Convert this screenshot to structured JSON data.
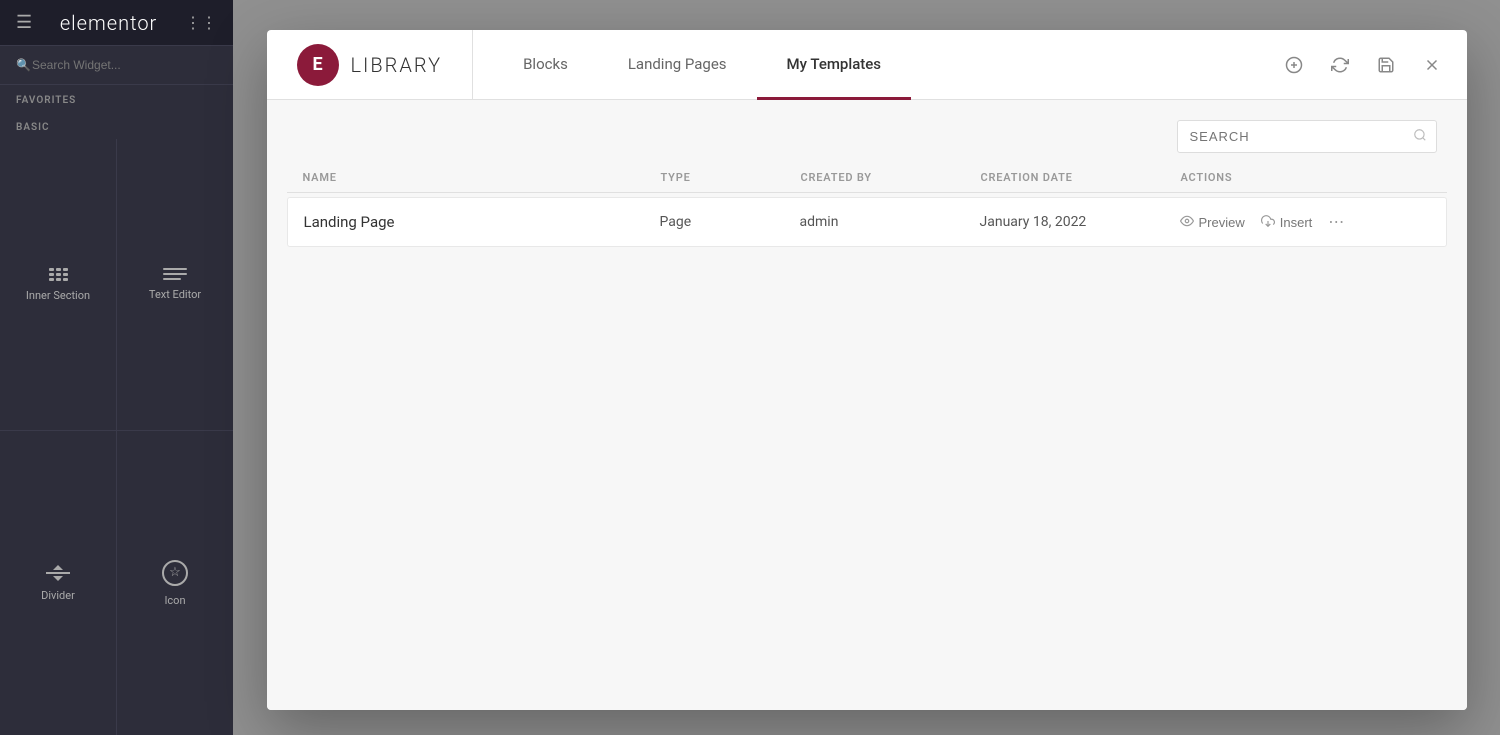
{
  "sidebar": {
    "logo_text": "elementor",
    "search_placeholder": "Search Widget...",
    "favorites_label": "FAVORITES",
    "basic_label": "BASIC",
    "widgets": [
      {
        "id": "inner-section",
        "label": "Inner Section"
      },
      {
        "id": "text-editor",
        "label": "Text Editor"
      },
      {
        "id": "divider",
        "label": "Divider"
      },
      {
        "id": "icon",
        "label": "Icon"
      }
    ]
  },
  "modal": {
    "brand_letter": "E",
    "library_title": "LIBRARY",
    "tabs": [
      {
        "id": "blocks",
        "label": "Blocks",
        "active": false
      },
      {
        "id": "landing-pages",
        "label": "Landing Pages",
        "active": false
      },
      {
        "id": "my-templates",
        "label": "My Templates",
        "active": true
      }
    ],
    "search_placeholder": "SEARCH",
    "table": {
      "headers": [
        {
          "id": "name",
          "label": "NAME"
        },
        {
          "id": "type",
          "label": "TYPE"
        },
        {
          "id": "created-by",
          "label": "CREATED BY"
        },
        {
          "id": "creation-date",
          "label": "CREATION DATE"
        },
        {
          "id": "actions",
          "label": "ACTIONS"
        }
      ],
      "rows": [
        {
          "name": "Landing Page",
          "type": "Page",
          "created_by": "admin",
          "creation_date": "January 18, 2022",
          "preview_label": "Preview",
          "insert_label": "Insert"
        }
      ]
    },
    "actions": {
      "upload_title": "Upload",
      "sync_title": "Sync",
      "save_title": "Save",
      "close_title": "Close"
    }
  }
}
